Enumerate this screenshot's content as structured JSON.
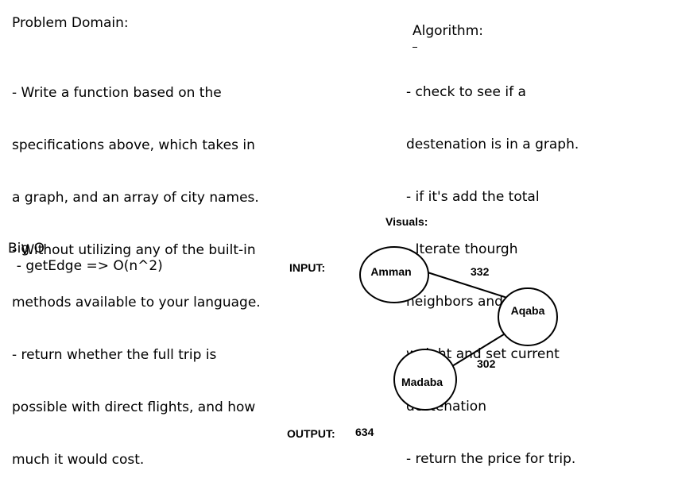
{
  "problem_domain": {
    "heading": "Problem Domain:",
    "lines": [
      "- Write a function based on the",
      "specifications above, which takes in",
      "a graph, and an array of city names.",
      "- Without utilizing any of the built-in",
      "methods available to your language.",
      "- return whether the full trip is",
      "possible with direct flights, and how",
      "much it would cost."
    ]
  },
  "algorithm": {
    "heading": "Algorithm:",
    "lines": [
      "- check to see if a",
      "destenation is in a graph.",
      "- if it's add the total",
      "- Iterate thourgh",
      "neighbors and add to",
      "weight and set current",
      "destenation",
      "- return the price for trip."
    ]
  },
  "big_o": {
    "heading": "Big O",
    "lines": [
      "  - getEdge => O(n^2)"
    ]
  },
  "visuals": {
    "heading": "Visuals:",
    "input_label": "INPUT:",
    "output_label": "OUTPUT:",
    "output_value": "634",
    "nodes": [
      {
        "id": "amman",
        "label": "Amman"
      },
      {
        "id": "aqaba",
        "label": "Aqaba"
      },
      {
        "id": "madaba",
        "label": "Madaba"
      }
    ],
    "edges": [
      {
        "from": "amman",
        "to": "aqaba",
        "weight": "332"
      },
      {
        "from": "aqaba",
        "to": "madaba",
        "weight": "302"
      }
    ]
  }
}
